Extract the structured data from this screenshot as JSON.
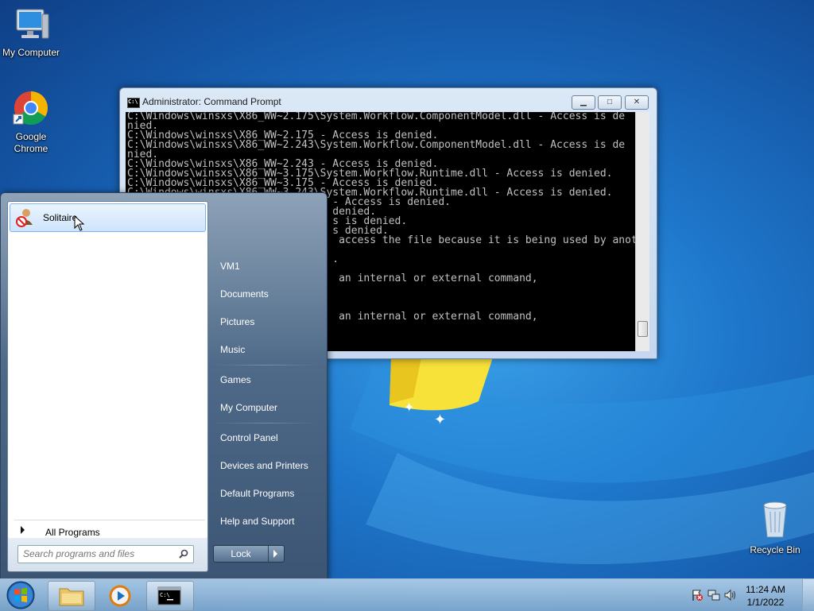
{
  "desktop": {
    "icons": [
      {
        "label": "My Computer"
      },
      {
        "label": "Google Chrome"
      },
      {
        "label": "Recycle Bin"
      }
    ]
  },
  "cmd_window": {
    "title": "Administrator: Command Prompt",
    "lines": [
      "C:\\Windows\\winsxs\\X86_WW~2.175\\System.Workflow.ComponentModel.dll - Access is de",
      "nied.",
      "C:\\Windows\\winsxs\\X86_WW~2.175 - Access is denied.",
      "C:\\Windows\\winsxs\\X86_WW~2.243\\System.Workflow.ComponentModel.dll - Access is de",
      "nied.",
      "C:\\Windows\\winsxs\\X86_WW~2.243 - Access is denied.",
      "C:\\Windows\\winsxs\\X86_WW~3.175\\System.Workflow.Runtime.dll - Access is denied.",
      "C:\\Windows\\winsxs\\X86_WW~3.175 - Access is denied.",
      "C:\\Windows\\winsxs\\X86_WW~3.243\\System.Workflow.Runtime.dll - Access is denied.",
      "                                 - Access is denied.",
      "                                 denied.",
      "                                 s is denied.",
      "                                 s denied.",
      "                                  access the file because it is being used by anot",
      "",
      "                                 .",
      "",
      "                                  an internal or external command,",
      "",
      "",
      "",
      "                                  an internal or external command,"
    ]
  },
  "start_menu": {
    "programs": [
      {
        "label": "Solitaire"
      }
    ],
    "all_programs_label": "All Programs",
    "search_placeholder": "Search programs and files",
    "right_links": [
      {
        "label": "VM1"
      },
      {
        "label": "Documents"
      },
      {
        "label": "Pictures"
      },
      {
        "label": "Music"
      },
      {
        "label": "Games"
      },
      {
        "label": "My Computer"
      },
      {
        "label": "Control Panel"
      },
      {
        "label": "Devices and Printers"
      },
      {
        "label": "Default Programs"
      },
      {
        "label": "Help and Support"
      }
    ],
    "lock_label": "Lock"
  },
  "taskbar": {
    "buttons": [
      {
        "icon": "folder-icon"
      },
      {
        "icon": "media-player-icon"
      },
      {
        "icon": "command-prompt-icon"
      }
    ],
    "clock": {
      "time": "11:24 AM",
      "date": "1/1/2022"
    }
  },
  "colors": {
    "desktop_blue": "#1f78cc",
    "console_bg": "#000000",
    "console_fg": "#c0c0c0"
  }
}
